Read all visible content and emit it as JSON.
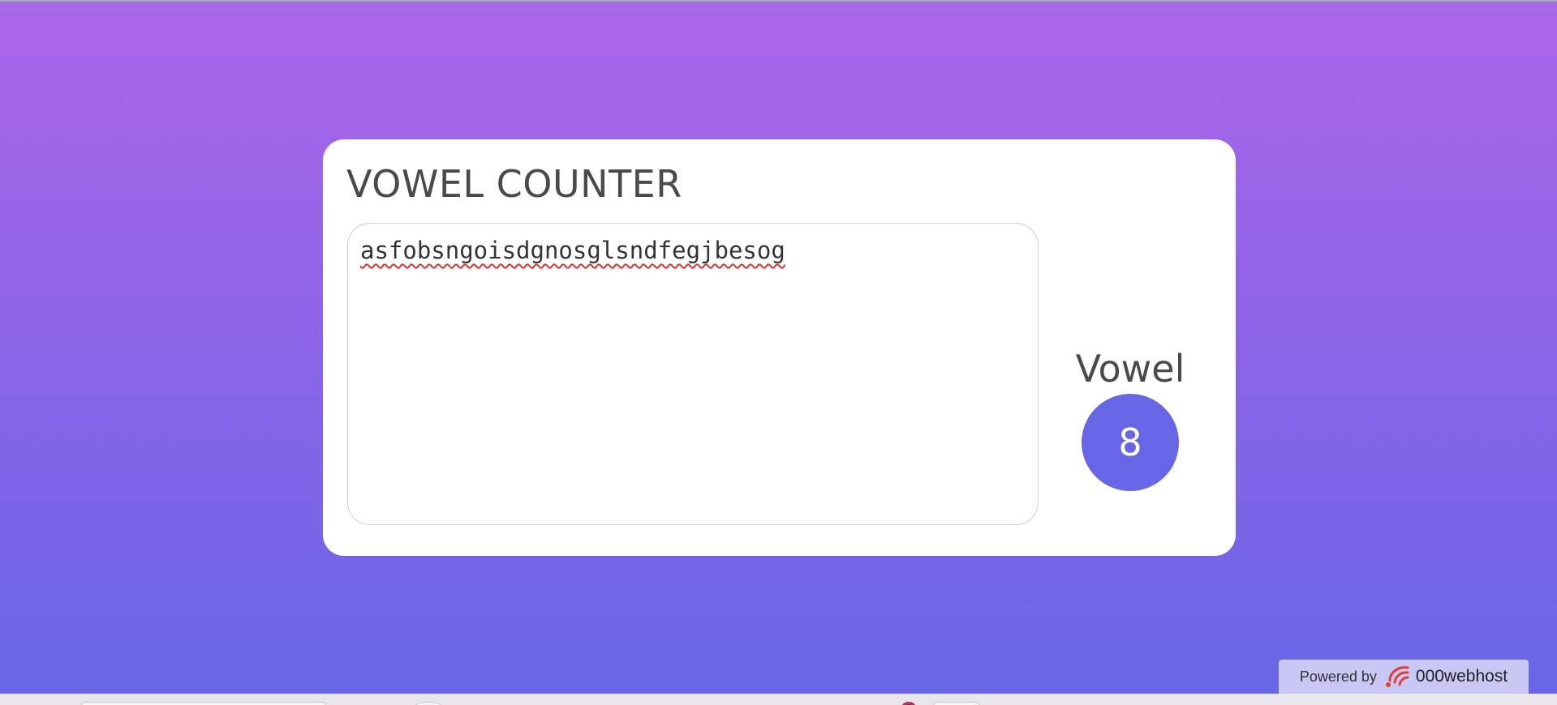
{
  "app": {
    "title": "VOWEL COUNTER"
  },
  "input": {
    "value": "asfobsngoisdgnosglsndfegjbesog"
  },
  "result": {
    "label": "Vowel",
    "count": "8"
  },
  "footer": {
    "powered_by": "Powered by",
    "brand": "000webhost"
  },
  "colors": {
    "background_top": "#ac66e9",
    "background_bottom": "#6666e6",
    "accent": "#6666e6",
    "card": "#ffffff",
    "text": "#4a4a4a"
  },
  "icons": {
    "brand_logo": "000webhost-logo-icon"
  }
}
